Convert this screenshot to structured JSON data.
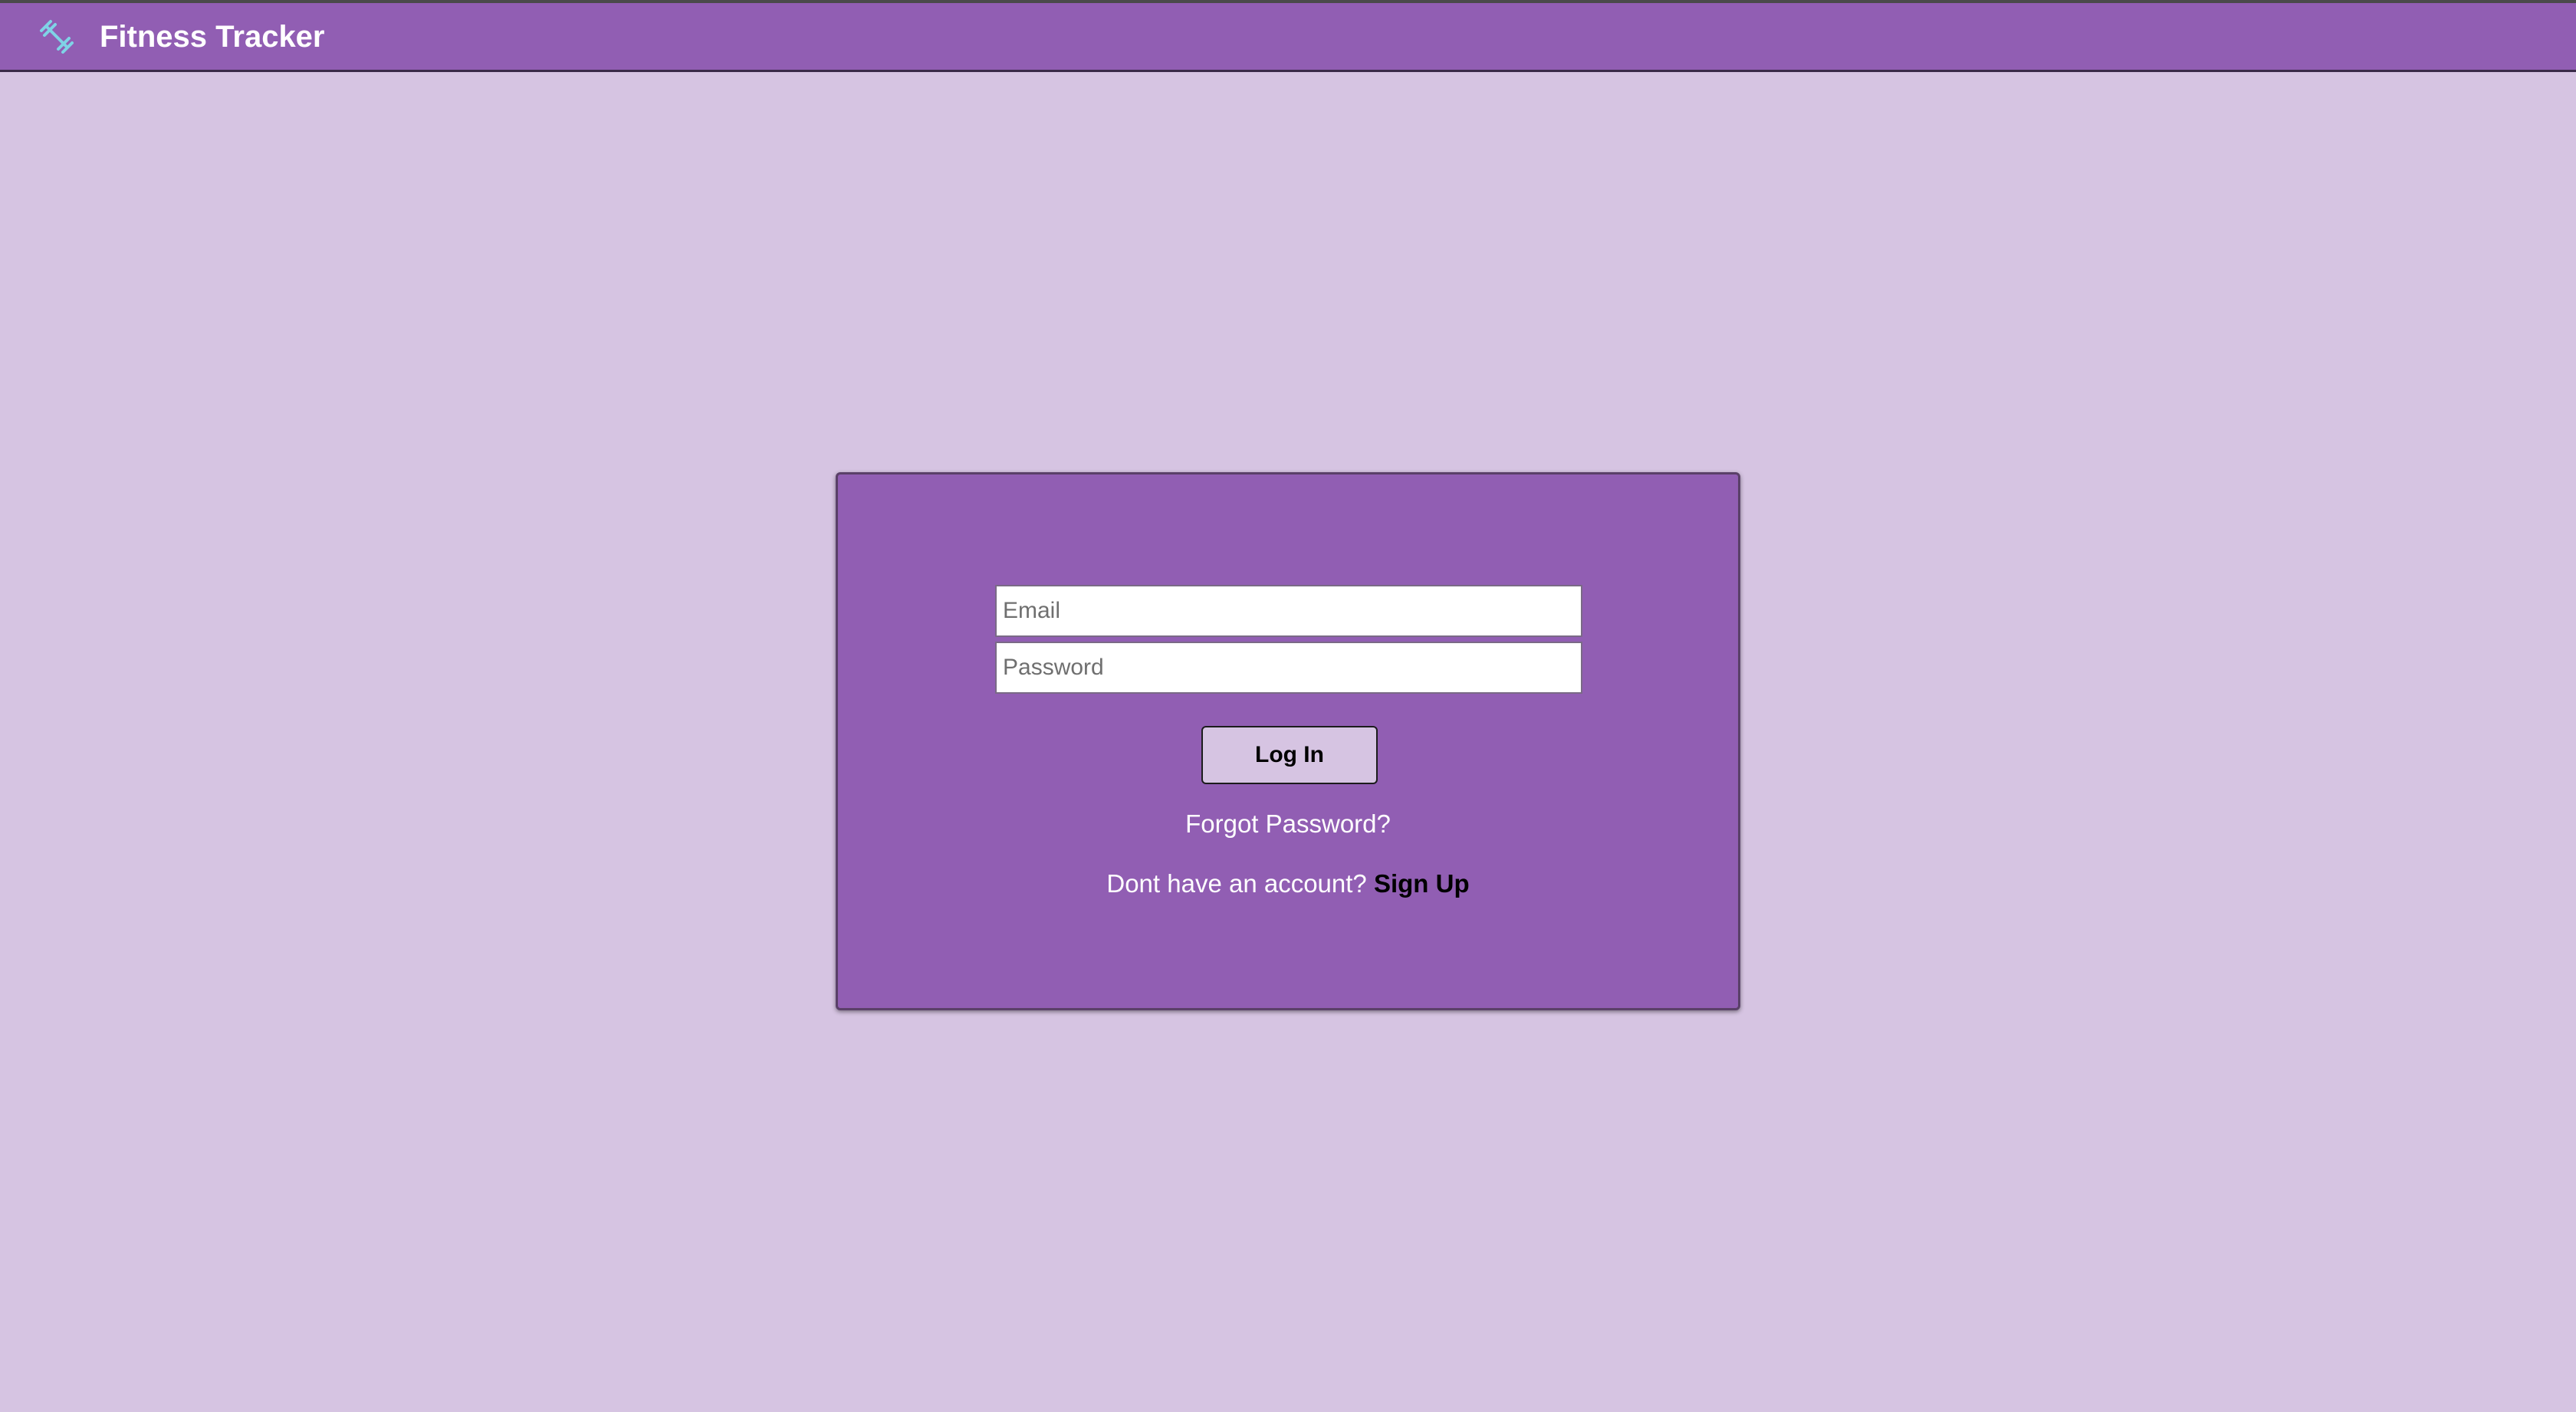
{
  "app": {
    "title": "Fitness Tracker",
    "brand_icon": "dumbbell-icon",
    "brand_icon_color": "#7fd3e6"
  },
  "colors": {
    "page_background": "#d6c4e2",
    "navbar_background": "#915eb3",
    "card_background": "#915eb3",
    "button_background": "#d6c4e2"
  },
  "login_form": {
    "email_placeholder": "Email",
    "email_value": "",
    "password_placeholder": "Password",
    "password_value": "",
    "login_button_label": "Log In",
    "forgot_password_label": "Forgot Password?",
    "signup_prompt": "Dont have an account?",
    "signup_link_label": "Sign Up"
  }
}
